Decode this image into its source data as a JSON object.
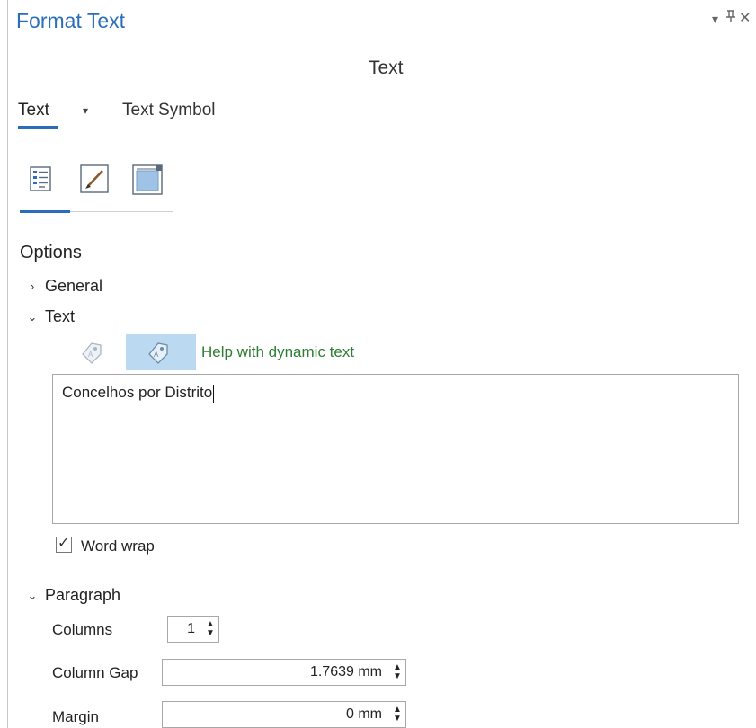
{
  "pane": {
    "title": "Format Text",
    "dropdown_icon": "▾",
    "pin_icon": "⊥",
    "close_icon": "✕"
  },
  "header": {
    "title": "Text"
  },
  "tabs": [
    {
      "label": "Text",
      "active": true
    },
    {
      "label": "Text Symbol",
      "active": false
    }
  ],
  "tab_dropdown_icon": "▾",
  "icon_tabs": [
    "text-properties-icon",
    "brush-icon",
    "background-frame-icon"
  ],
  "options": {
    "heading": "Options",
    "general": {
      "label": "General",
      "expanded": false
    },
    "text": {
      "label": "Text",
      "expanded": true,
      "dynamic_help": "Help with dynamic text",
      "value": "Concelhos por Distrito",
      "word_wrap": {
        "label": "Word wrap",
        "checked": true
      }
    },
    "paragraph": {
      "label": "Paragraph",
      "expanded": true,
      "columns": {
        "label": "Columns",
        "value": "1"
      },
      "column_gap": {
        "label": "Column Gap",
        "value": "1.7639 mm"
      },
      "margin": {
        "label": "Margin",
        "value": "0 mm"
      }
    }
  },
  "colors": {
    "accent": "#2a6ebb",
    "link_green": "#2e7d32",
    "selected_btn": "#bcd9f2"
  }
}
